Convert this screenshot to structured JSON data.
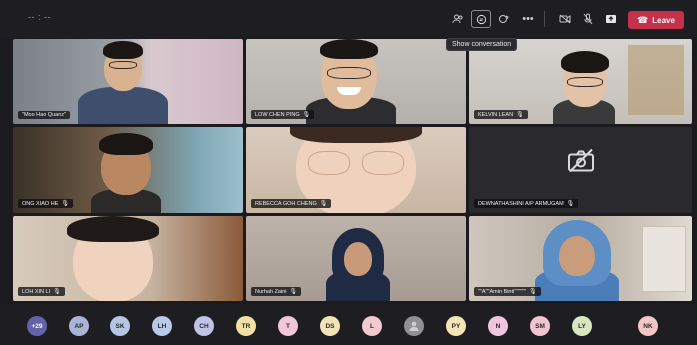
{
  "topbar": {
    "timer": "-- : --",
    "icons": [
      "people-icon",
      "chat-icon",
      "reactions-icon",
      "more-icon",
      "camera-icon",
      "mic-icon",
      "share-icon"
    ],
    "leave_label": "Leave",
    "tooltip": "Show conversation"
  },
  "participants": [
    {
      "name": "\"Moo Hao Quanz\"",
      "tile": "t1"
    },
    {
      "name": "LOW CHEN PING",
      "tile": "t2"
    },
    {
      "name": "KELVIN LEAN",
      "tile": "t3"
    },
    {
      "name": "ONG XIAO HE",
      "tile": "t4"
    },
    {
      "name": "REBECCA GOH CHENG",
      "tile": "t5"
    },
    {
      "name": "DEWNATHASHINI A/P ARMUGAM",
      "tile": "t6",
      "camera": "off"
    },
    {
      "name": "LOH XIN LI",
      "tile": "t7"
    },
    {
      "name": "Nurhah Zaini",
      "tile": "t8"
    },
    {
      "name": "\"\"A\"\"Amin Binti\"\"\"\"\"\"",
      "tile": "t9"
    }
  ],
  "roster": [
    {
      "initials": "+29",
      "color": "#6264a7"
    },
    {
      "initials": "AP",
      "color": "#a9b4d8"
    },
    {
      "initials": "SK",
      "color": "#b7c6e4"
    },
    {
      "initials": "LH",
      "color": "#b9c9ea"
    },
    {
      "initials": "CH",
      "color": "#c1c3e6"
    },
    {
      "initials": "TR",
      "color": "#f2e0a4"
    },
    {
      "initials": "T",
      "color": "#f0c6d8"
    },
    {
      "initials": "DS",
      "color": "#f3e3b7"
    },
    {
      "initials": "L",
      "color": "#f2c9cf"
    },
    {
      "initials": "",
      "color": "#8f8f94",
      "icon": "avatar-photo-icon"
    },
    {
      "initials": "PY",
      "color": "#f4e6b4"
    },
    {
      "initials": "N",
      "color": "#f1c5de"
    },
    {
      "initials": "SM",
      "color": "#f2c3d1"
    },
    {
      "initials": "LY",
      "color": "#d9e6bf"
    },
    {
      "initials": "NK",
      "color": "#f3c6c8"
    }
  ]
}
